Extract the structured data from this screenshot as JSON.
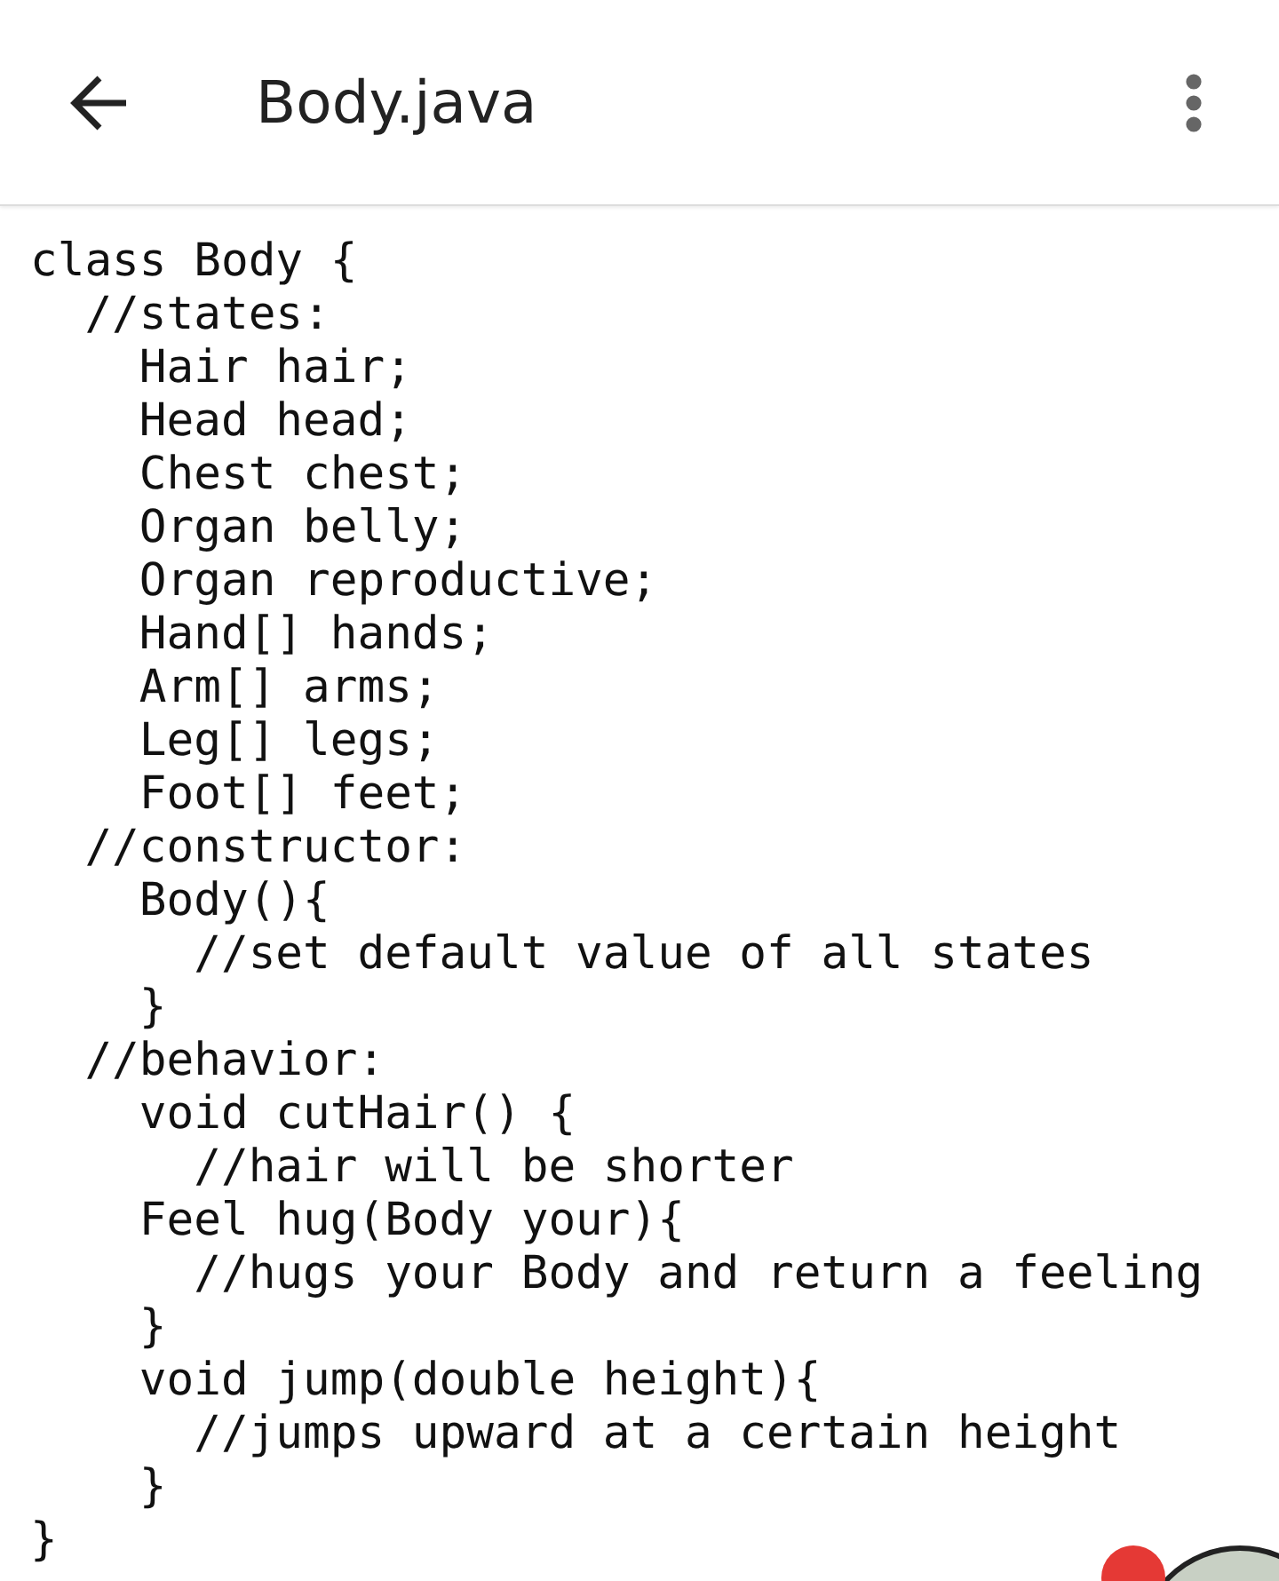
{
  "app_bar": {
    "title": "Body.java"
  },
  "code_lines": [
    "class Body {",
    "  //states:",
    "    Hair hair;",
    "    Head head;",
    "    Chest chest;",
    "    Organ belly;",
    "    Organ reproductive;",
    "    Hand[] hands;",
    "    Arm[] arms;",
    "    Leg[] legs;",
    "    Foot[] feet;",
    "  //constructor:",
    "    Body(){",
    "      //set default value of all states",
    "    }",
    "  //behavior:",
    "    void cutHair() {",
    "      //hair will be shorter",
    "    Feel hug(Body your){",
    "      //hugs your Body and return a feeling",
    "    }",
    "    void jump(double height){",
    "      //jumps upward at a certain height",
    "    }",
    "}"
  ]
}
